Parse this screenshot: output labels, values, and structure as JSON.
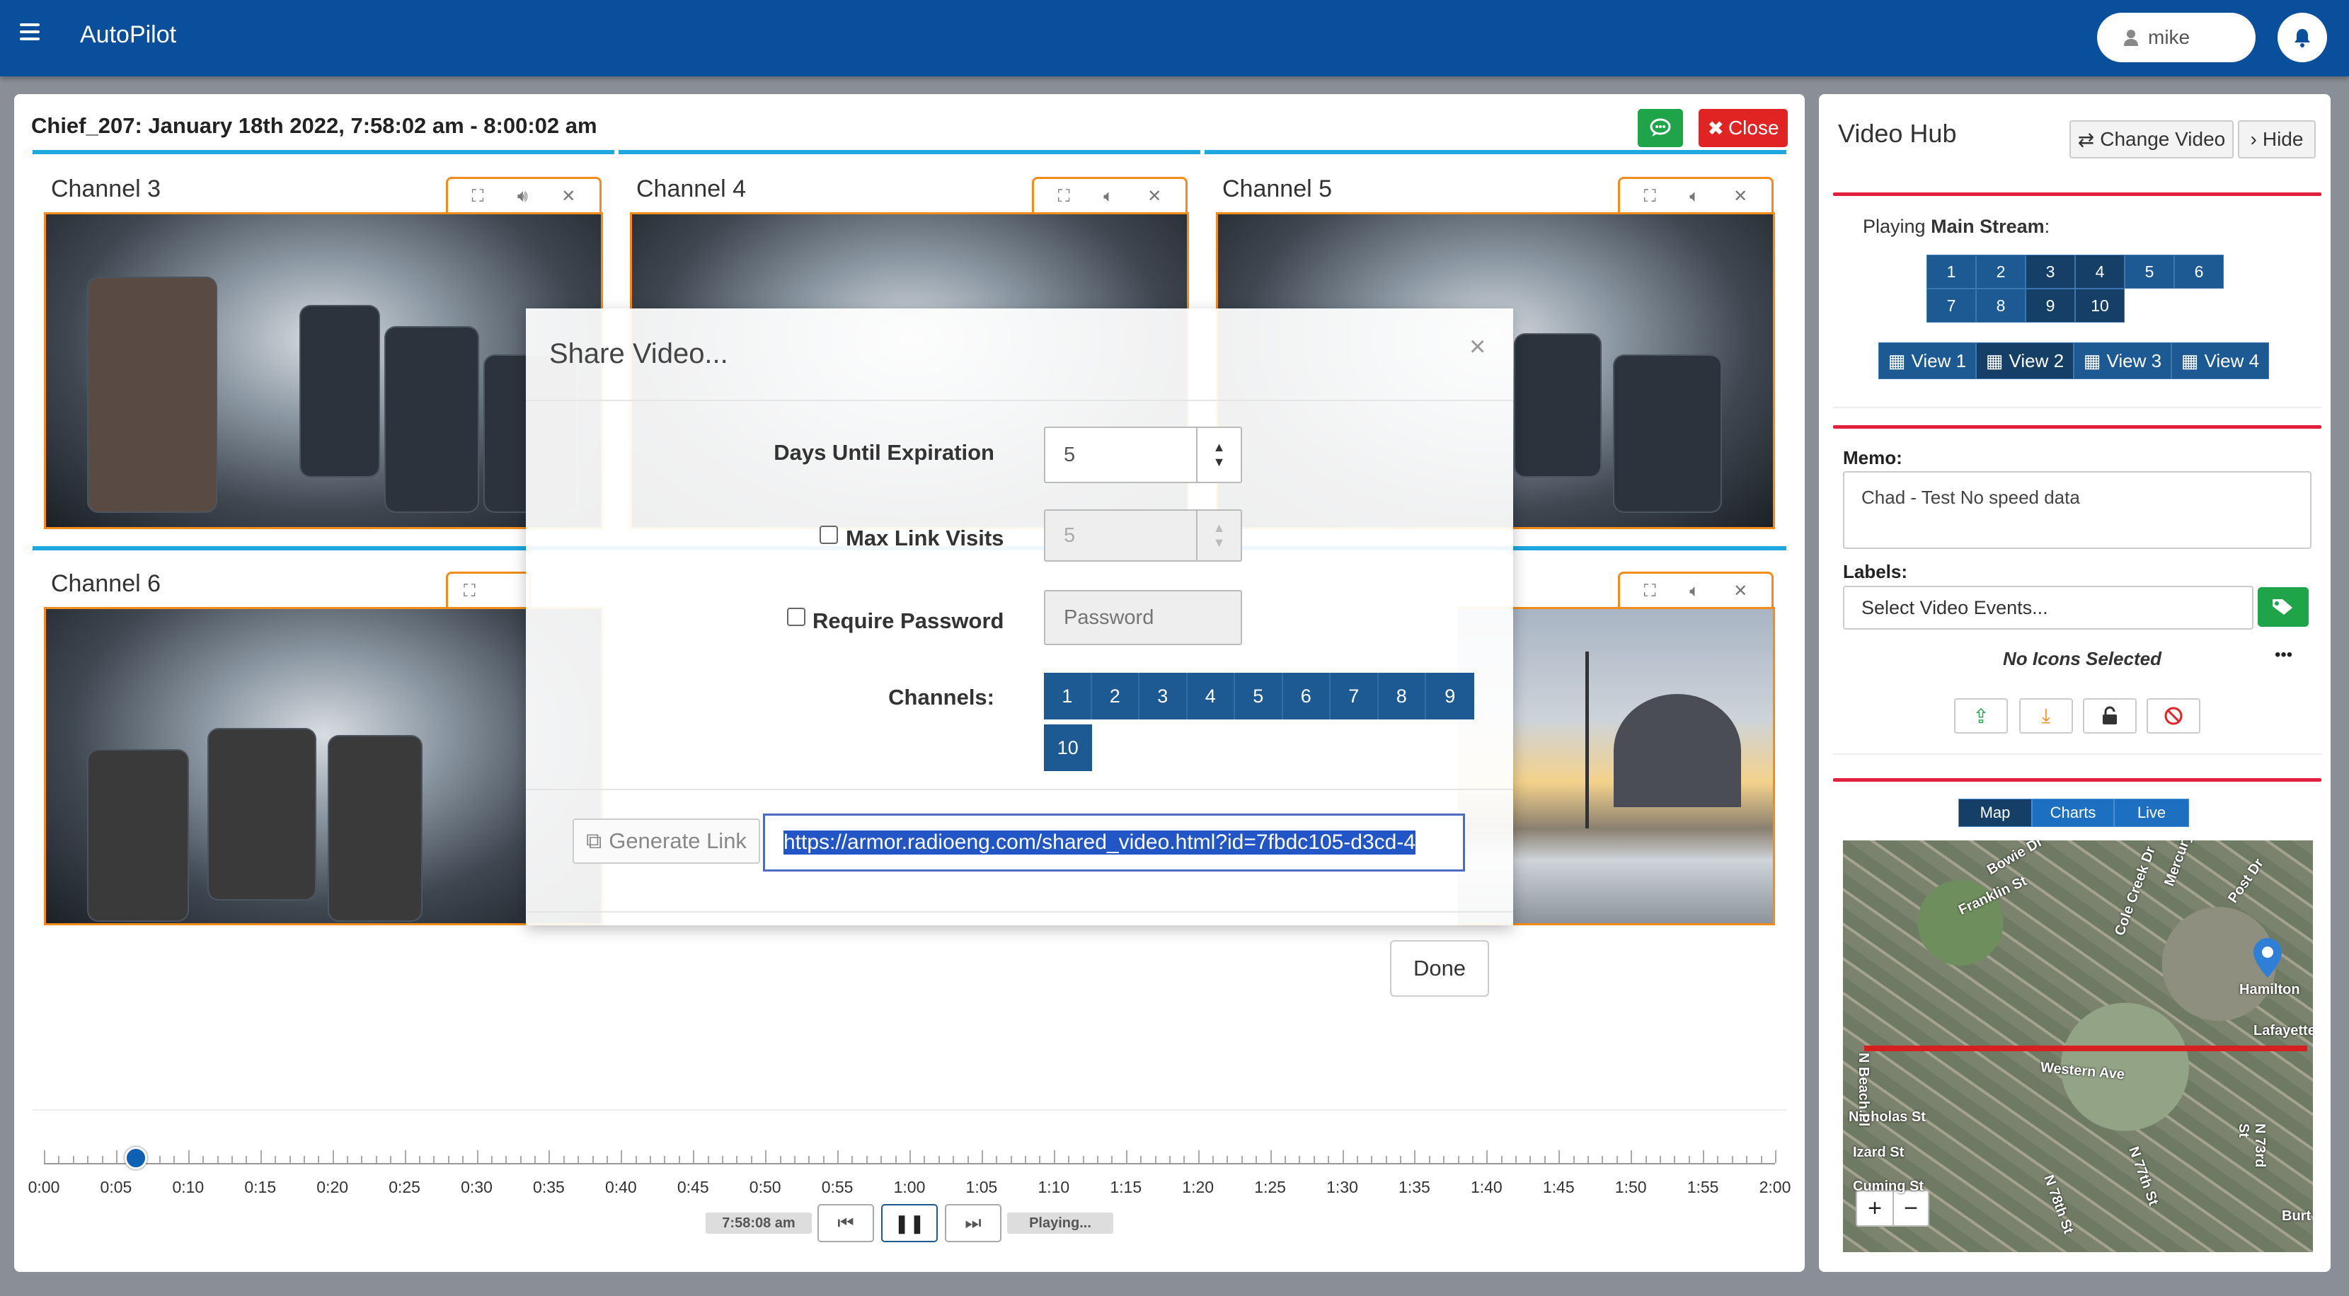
{
  "app": {
    "title": "AutoPilot",
    "user": "mike"
  },
  "video": {
    "title": "Chief_207: January 18th 2022, 7:58:02 am - 8:00:02 am",
    "close_label": "Close",
    "channels": [
      "Channel 3",
      "Channel 4",
      "Channel 5",
      "Channel 6"
    ]
  },
  "share_dialog": {
    "title": "Share Video...",
    "close_glyph": "×",
    "days_label": "Days Until Expiration",
    "days_value": "5",
    "max_visits_label": "Max Link Visits",
    "max_visits_value": "5",
    "password_label": "Require Password",
    "password_placeholder": "Password",
    "channels_label": "Channels:",
    "channel_buttons": [
      "1",
      "2",
      "3",
      "4",
      "5",
      "6",
      "7",
      "8",
      "9",
      "10"
    ],
    "generate_label": "Generate Link",
    "link": "https://armor.radioeng.com/shared_video.html?id=7fbdc105-d3cd-4",
    "done_label": "Done"
  },
  "playback": {
    "time_labels": [
      "0:00",
      "0:05",
      "0:10",
      "0:15",
      "0:20",
      "0:25",
      "0:30",
      "0:35",
      "0:40",
      "0:45",
      "0:50",
      "0:55",
      "1:00",
      "1:05",
      "1:10",
      "1:15",
      "1:20",
      "1:25",
      "1:30",
      "1:35",
      "1:40",
      "1:45",
      "1:50",
      "1:55",
      "2:00"
    ],
    "current_time": "7:58:08 am",
    "status": "Playing...",
    "progress_seconds": 5
  },
  "hub": {
    "title": "Video Hub",
    "change_label": "Change Video",
    "hide_label": "Hide",
    "playing_prefix": "Playing",
    "playing_stream": "Main Stream",
    "playing_suffix": ":",
    "stream_buttons": [
      "1",
      "2",
      "3",
      "4",
      "5",
      "6",
      "7",
      "8",
      "9",
      "10"
    ],
    "active_streams": [
      "3",
      "4",
      "9",
      "10"
    ],
    "views": [
      "View 1",
      "View 2",
      "View 3",
      "View 4"
    ],
    "active_view": "View 2",
    "memo_label": "Memo:",
    "memo_value": "Chad - Test No speed data",
    "labels_label": "Labels:",
    "labels_placeholder": "Select Video Events...",
    "no_icons": "No Icons Selected",
    "more_glyph": "•••",
    "map_tabs": [
      "Map",
      "Charts",
      "Live"
    ],
    "active_map_tab": "Map",
    "map_streets": [
      "Bowie Dr",
      "Franklin St",
      "Cole Creek Dr",
      "Mercury Dr",
      "Post Dr",
      "Hamilton",
      "Lafayette",
      "Western Ave",
      "Nicholas St",
      "Izard St",
      "Cuming St",
      "N 78th St",
      "N 77th St",
      "N 73rd St",
      "Burt",
      "N Beach Pl"
    ]
  },
  "colors": {
    "header": "#0a4f9c",
    "accent": "#1d5a93",
    "danger": "#e02424",
    "success": "#20a44a",
    "tile_border": "#f28c1a"
  }
}
